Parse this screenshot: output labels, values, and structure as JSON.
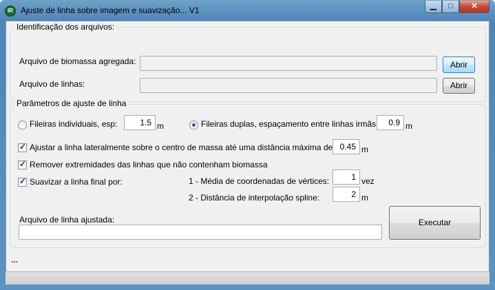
{
  "window": {
    "title": "Ajuste de linha sobre imagem e suavização... V1",
    "icon": "IR",
    "minimize": "▁",
    "maximize": "□",
    "close": "✕"
  },
  "files": {
    "group_title": "Identificação dos arquivos:",
    "biomass_label": "Arquivo de biomassa agregada:",
    "biomass_value": "",
    "lines_label": "Arquivo de linhas:",
    "lines_value": "",
    "open_label": "Abrir"
  },
  "params": {
    "group_title": "Parâmetros de ajuste de linha",
    "individual_label": "Fileiras individuais, esp:",
    "individual_value": "1.5",
    "individual_unit": "m",
    "individual_selected": false,
    "double_label": "Fileiras duplas, espaçamento entre linhas irmãs:",
    "double_value": "0.9",
    "double_unit": "m",
    "double_selected": true,
    "adjust_label": "Ajustar a linha lateralmente sobre o centro de massa até uma distância máxima de:",
    "adjust_value": "0.45",
    "adjust_unit": "m",
    "adjust_checked": true,
    "remove_label": "Remover extremidades das linhas que não contenham biomassa",
    "remove_checked": true,
    "smooth_label": "Suavizar a linha final por:",
    "smooth_checked": true,
    "mean_label": "1 - Média de coordenadas de vértices:",
    "mean_value": "1",
    "mean_unit": "vez",
    "spline_label": "2 - Distância de interpolação spline:",
    "spline_value": "2",
    "spline_unit": "m"
  },
  "output": {
    "label": "Arquivo de linha ajustada:",
    "value": "",
    "execute_label": "Executar"
  },
  "status_dots": "..."
}
